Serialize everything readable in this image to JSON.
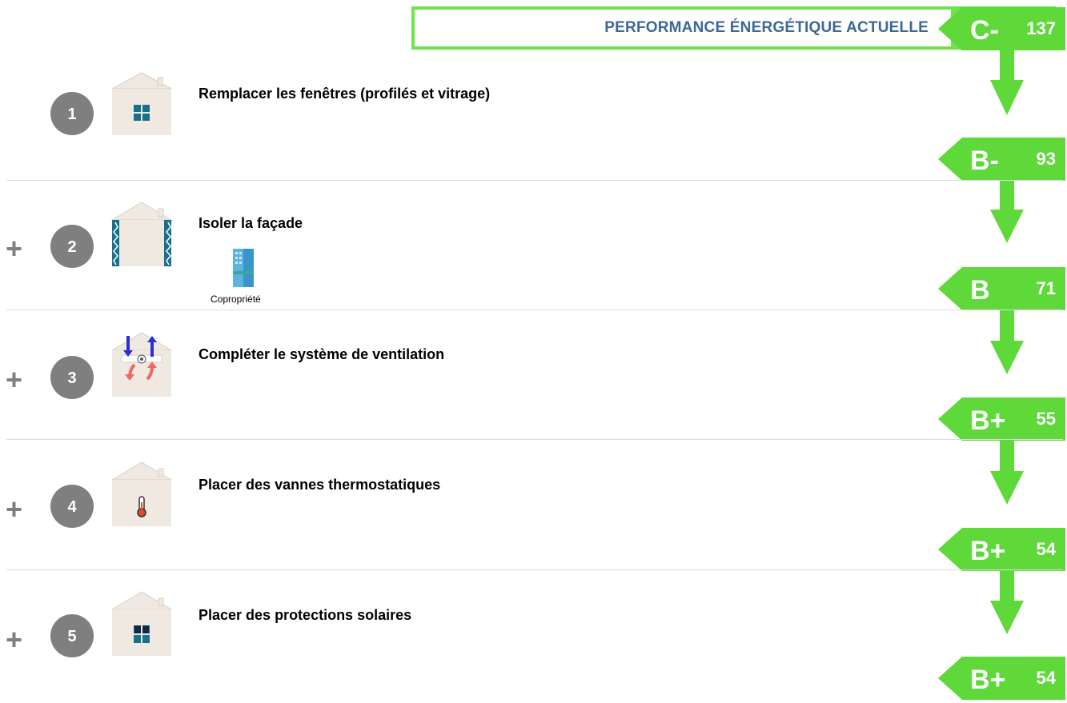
{
  "current": {
    "label": "PERFORMANCE ÉNERGÉTIQUE ACTUELLE",
    "class": "C-",
    "value": "137"
  },
  "colors": {
    "accent_green": "#5fd83a",
    "label_blue": "#3c679b",
    "circle_gray": "#7f7f7f",
    "house_fill": "#efe9e1",
    "icon_teal": "#17708c"
  },
  "steps": [
    {
      "number": "1",
      "prefix": "",
      "title": "Remplacer les fenêtres (profilés et vitrage)",
      "icon": "windows-icon",
      "result": {
        "class": "B-",
        "value": "93"
      }
    },
    {
      "number": "2",
      "prefix": "+",
      "title": "Isoler la façade",
      "icon": "facade-insulation-icon",
      "sub_label": "Copropriété",
      "result": {
        "class": "B",
        "value": "71"
      }
    },
    {
      "number": "3",
      "prefix": "+",
      "title": "Compléter le système de ventilation",
      "icon": "ventilation-icon",
      "result": {
        "class": "B+",
        "value": "55"
      }
    },
    {
      "number": "4",
      "prefix": "+",
      "title": "Placer des vannes thermostatiques",
      "icon": "thermostat-icon",
      "result": {
        "class": "B+",
        "value": "54"
      }
    },
    {
      "number": "5",
      "prefix": "+",
      "title": "Placer des protections solaires",
      "icon": "sun-protection-icon",
      "result": {
        "class": "B+",
        "value": "54"
      }
    }
  ]
}
